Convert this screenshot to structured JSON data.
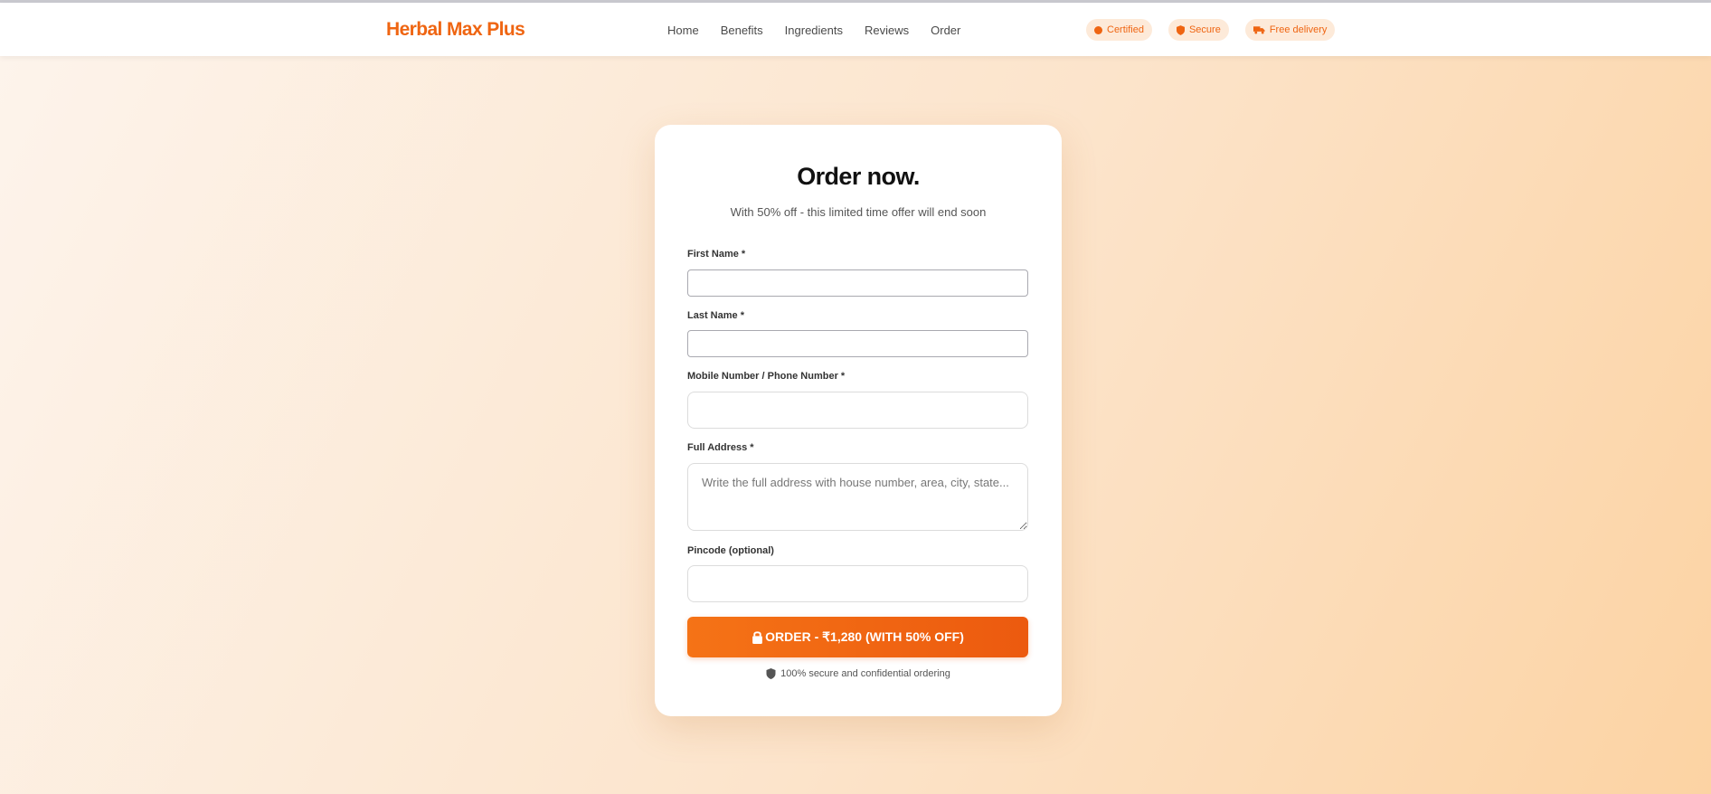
{
  "header": {
    "brand": "Herbal Max Plus",
    "nav": [
      "Home",
      "Benefits",
      "Ingredients",
      "Reviews",
      "Order"
    ],
    "badges": [
      {
        "label": "Certified",
        "icon": "circle-icon"
      },
      {
        "label": "Secure",
        "icon": "shield-icon"
      },
      {
        "label": "Free delivery",
        "icon": "truck-icon"
      }
    ]
  },
  "form": {
    "title": "Order now.",
    "subtitle": "With 50% off - this limited time offer will end soon",
    "first_name_label": "First Name *",
    "first_name_value": "",
    "last_name_label": "Last Name *",
    "last_name_value": "",
    "phone_label": "Mobile Number / Phone Number *",
    "phone_value": "",
    "address_label": "Full Address *",
    "address_placeholder": "Write the full address with house number, area, city, state...",
    "pincode_label": "Pincode (optional)",
    "pincode_value": "",
    "submit_label": "ORDER - ₹1,280 (WITH 50% OFF)",
    "secure_note": "100% secure and confidential ordering"
  },
  "colors": {
    "accent": "#ef6512",
    "badge_bg": "#fdead9",
    "card_bg": "#ffffff"
  }
}
